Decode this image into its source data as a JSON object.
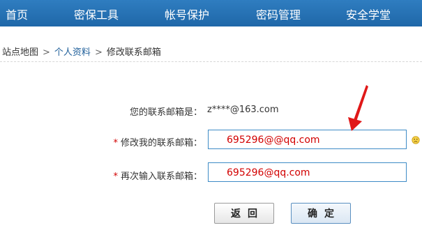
{
  "nav": {
    "items": [
      {
        "label": "首页"
      },
      {
        "label": "密保工具"
      },
      {
        "label": "帐号保护"
      },
      {
        "label": "密码管理"
      },
      {
        "label": "安全学堂"
      }
    ]
  },
  "breadcrumb": {
    "root": "站点地图",
    "section": "个人资料",
    "current": "修改联系邮箱",
    "separator": ">"
  },
  "form": {
    "current_label": "您的联系邮箱是：",
    "current_value": "z****@163.com",
    "required_mark": "*",
    "new_label": "修改我的联系邮箱：",
    "new_value": "695296@@qq.com",
    "confirm_label": "再次输入联系邮箱：",
    "confirm_value": "695296@qq.com"
  },
  "buttons": {
    "back": "返回",
    "ok": "确定"
  },
  "colors": {
    "nav_bg": "#1f67a8",
    "input_border": "#3d8bc6",
    "error_text": "#d20000",
    "annotation_arrow": "#e01818"
  },
  "icons": {
    "validation": "sad-face-icon"
  }
}
